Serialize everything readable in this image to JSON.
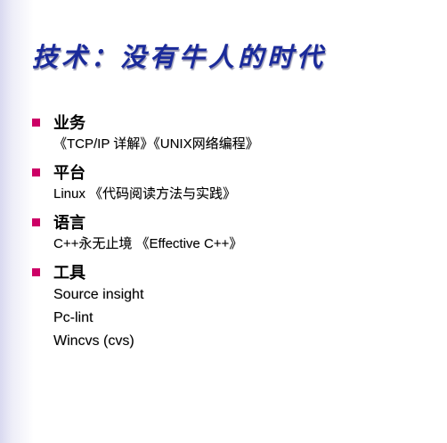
{
  "title": "技术：没有牛人的时代",
  "sections": [
    {
      "heading": "业务",
      "items": [
        "《TCP/IP 详解》《UNIX网络编程》"
      ]
    },
    {
      "heading": "平台",
      "items": [
        "Linux 《代码阅读方法与实践》"
      ]
    },
    {
      "heading": "语言",
      "items": [
        "C++永无止境 《Effective C++》"
      ]
    },
    {
      "heading": "工具",
      "items": [
        "Source insight",
        "Pc-lint",
        "Wincvs (cvs)"
      ]
    }
  ],
  "colors": {
    "title": "#1a2a9a",
    "bullet": "#cc0066"
  }
}
